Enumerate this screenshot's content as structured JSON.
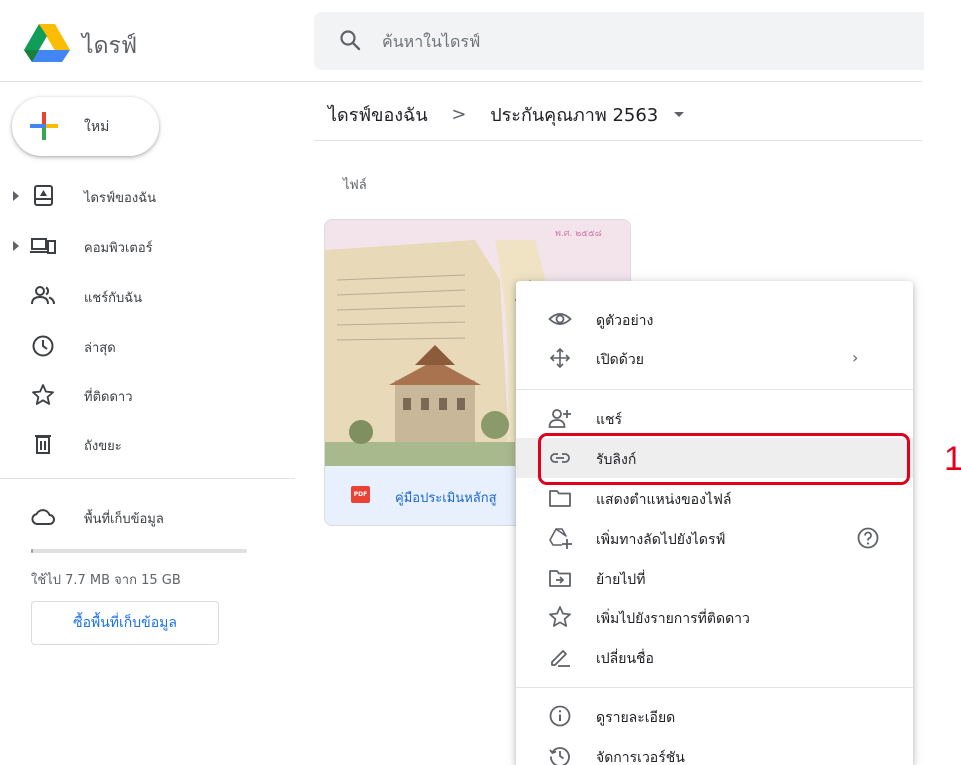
{
  "header": {
    "app_title": "ไดรฟ์",
    "search_placeholder": "ค้นหาในไดรฟ์"
  },
  "sidebar": {
    "new_label": "ใหม่",
    "items": [
      {
        "label": "ไดรฟ์ของฉัน",
        "icon": "my-drive-icon",
        "expandable": true
      },
      {
        "label": "คอมพิวเตอร์",
        "icon": "computers-icon",
        "expandable": true
      },
      {
        "label": "แชร์กับฉัน",
        "icon": "shared-people-icon",
        "expandable": false
      },
      {
        "label": "ล่าสุด",
        "icon": "clock-icon",
        "expandable": false
      },
      {
        "label": "ที่ติดดาว",
        "icon": "star-icon",
        "expandable": false
      },
      {
        "label": "ถังขยะ",
        "icon": "trash-icon",
        "expandable": false
      }
    ],
    "storage": {
      "label": "พื้นที่เก็บข้อมูล",
      "usage_text": "ใช้ไป 7.7 MB จาก 15 GB",
      "used_fraction": 0.0005,
      "buy_label": "ซื้อพื้นที่เก็บข้อมูล"
    }
  },
  "breadcrumb": {
    "root": "ไดรฟ์ของฉัน",
    "separator": ">",
    "current": "ประกันคุณภาพ 2563"
  },
  "main": {
    "section_label": "ไฟล์",
    "file": {
      "name": "คู่มือประเมินหลักสู",
      "type_badge": "PDF",
      "thumb_text": "พ.ศ. ๒๕๕๘"
    }
  },
  "context_menu": {
    "items": [
      {
        "label": "ดูตัวอย่าง",
        "icon": "eye-icon"
      },
      {
        "label": "เปิดด้วย",
        "icon": "open-with-icon",
        "submenu": true
      },
      {
        "label": "แชร์",
        "icon": "person-add-icon"
      },
      {
        "label": "รับลิงก์",
        "icon": "link-icon",
        "highlighted": true
      },
      {
        "label": "แสดงตำแหน่งของไฟล์",
        "icon": "folder-icon"
      },
      {
        "label": "เพิ่มทางลัดไปยังไดรฟ์",
        "icon": "add-shortcut-icon",
        "help": true
      },
      {
        "label": "ย้ายไปที่",
        "icon": "move-to-icon"
      },
      {
        "label": "เพิ่มไปยังรายการที่ติดดาว",
        "icon": "star-icon"
      },
      {
        "label": "เปลี่ยนชื่อ",
        "icon": "rename-pen-icon"
      },
      {
        "label": "ดูรายละเอียด",
        "icon": "info-icon"
      },
      {
        "label": "จัดการเวอร์ชัน",
        "icon": "history-icon"
      }
    ]
  },
  "annotation": {
    "callout_number": "1",
    "callout_color": "#e0001b"
  },
  "colors": {
    "accent_blue": "#1a73e8",
    "file_card_footer": "#e8f0fe",
    "menu_highlight": "#eeeeee"
  }
}
